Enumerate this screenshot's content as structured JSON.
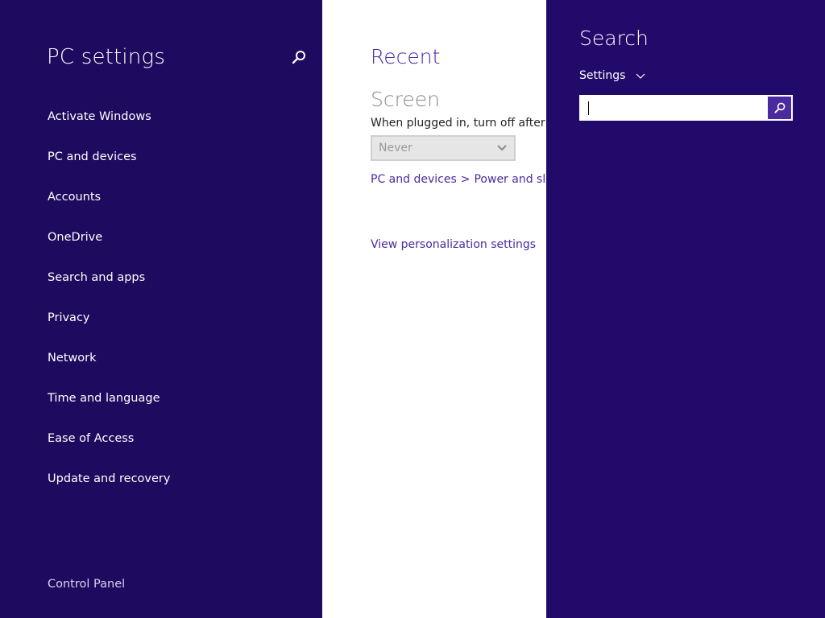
{
  "nav": {
    "title": "PC settings",
    "search_icon": "search-icon",
    "items": [
      {
        "label": "Activate Windows"
      },
      {
        "label": "PC and devices"
      },
      {
        "label": "Accounts"
      },
      {
        "label": "OneDrive"
      },
      {
        "label": "Search and apps"
      },
      {
        "label": "Privacy"
      },
      {
        "label": "Network"
      },
      {
        "label": "Time and language"
      },
      {
        "label": "Ease of Access"
      },
      {
        "label": "Update and recovery"
      }
    ],
    "control_panel": "Control Panel"
  },
  "content": {
    "recent_title": "Recent",
    "screen_title": "Screen",
    "setting_label": "When plugged in, turn off after",
    "dropdown_value": "Never",
    "crumb_part1": "PC and devices",
    "crumb_sep": ">",
    "crumb_part2": "Power and sleep",
    "view_link": "View personalization settings"
  },
  "charm": {
    "title": "Search",
    "scope": "Settings",
    "search_value": "",
    "search_icon": "search-icon"
  },
  "colors": {
    "nav_bg": "#1e0a5e",
    "charm_bg": "#220a6a",
    "accent": "#4b2aa0"
  }
}
